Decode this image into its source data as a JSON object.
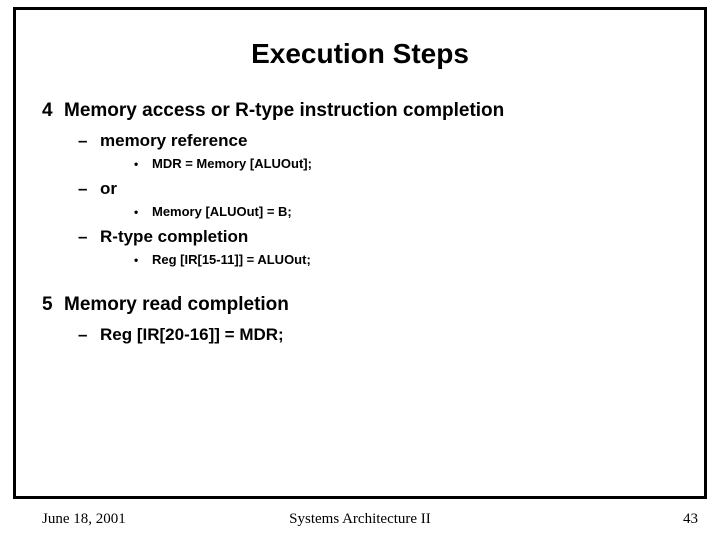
{
  "title": "Execution Steps",
  "items": [
    {
      "num": "4",
      "text": "Memory access or R-type instruction completion",
      "sub": [
        {
          "text": "memory reference",
          "sub": [
            {
              "text": "MDR = Memory [ALUOut];"
            }
          ]
        },
        {
          "text": "or",
          "sub": [
            {
              "text": "Memory [ALUOut] = B;"
            }
          ]
        },
        {
          "text": "R-type completion",
          "sub": [
            {
              "text": "Reg [IR[15-11]] = ALUOut;"
            }
          ]
        }
      ]
    },
    {
      "num": "5",
      "text": "Memory read completion",
      "sub": [
        {
          "text": "Reg [IR[20-16]] = MDR;",
          "sub": []
        }
      ]
    }
  ],
  "footer": {
    "date": "June 18, 2001",
    "center": "Systems Architecture II",
    "page": "43"
  }
}
